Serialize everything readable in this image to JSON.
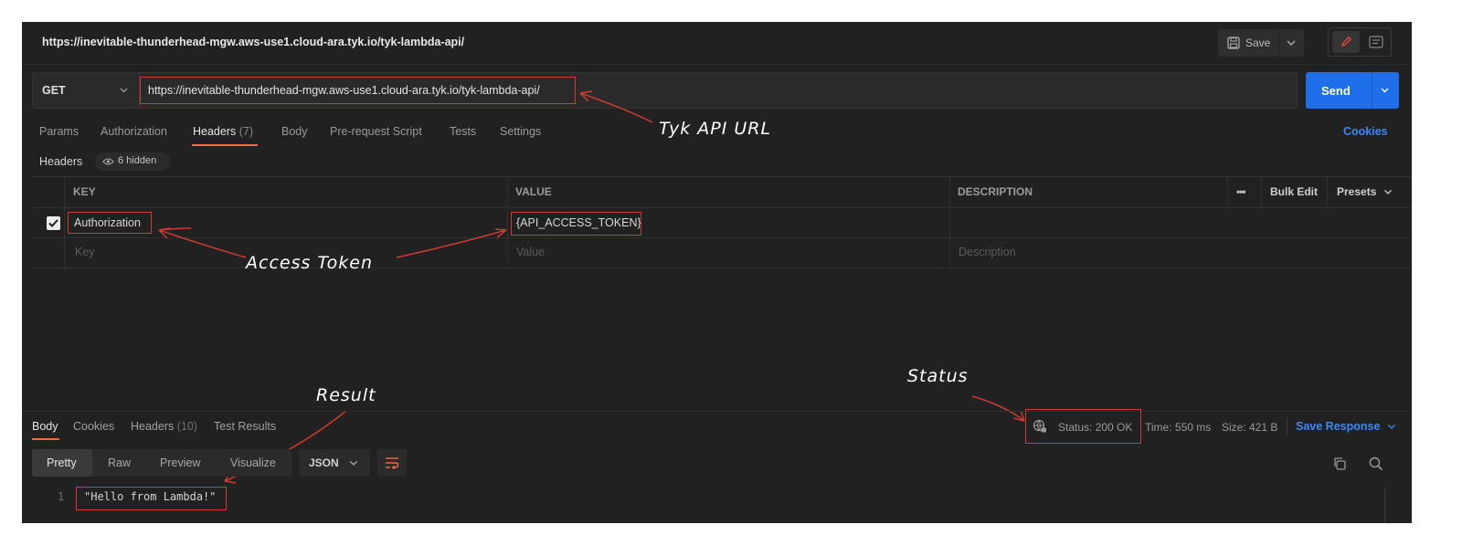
{
  "request": {
    "title": "https://inevitable-thunderhead-mgw.aws-use1.cloud-ara.tyk.io/tyk-lambda-api/",
    "save_label": "Save",
    "method": "GET",
    "url": "https://inevitable-thunderhead-mgw.aws-use1.cloud-ara.tyk.io/tyk-lambda-api/",
    "send_label": "Send"
  },
  "tabs": {
    "params": "Params",
    "authorization": "Authorization",
    "headers": "Headers",
    "headers_count": "(7)",
    "body": "Body",
    "prerequest": "Pre-request Script",
    "tests": "Tests",
    "settings": "Settings",
    "cookies": "Cookies"
  },
  "headers_section": {
    "label": "Headers",
    "hidden": "6 hidden",
    "columns": {
      "key": "KEY",
      "value": "VALUE",
      "description": "DESCRIPTION"
    },
    "more": "•••",
    "bulk_edit": "Bulk Edit",
    "presets": "Presets",
    "rows": [
      {
        "key": "Authorization",
        "value": "{API_ACCESS_TOKEN}",
        "description": ""
      }
    ],
    "placeholders": {
      "key": "Key",
      "value": "Value",
      "description": "Description"
    }
  },
  "response": {
    "tabs": {
      "body": "Body",
      "cookies": "Cookies",
      "headers": "Headers",
      "headers_count": "(10)",
      "test_results": "Test Results"
    },
    "status": "Status: 200 OK",
    "time": "Time: 550 ms",
    "size": "Size: 421 B",
    "save_response": "Save Response",
    "views": {
      "pretty": "Pretty",
      "raw": "Raw",
      "preview": "Preview",
      "visualize": "Visualize"
    },
    "format": "JSON",
    "line_number": "1",
    "body_text": "\"Hello from Lambda!\""
  },
  "annotations": {
    "url": "Tyk API URL",
    "token": "Access Token",
    "result": "Result",
    "status": "Status"
  },
  "colors": {
    "accent_orange": "#ef6c3e",
    "send_blue": "#1f6fea",
    "link_blue": "#3b88f5",
    "annotation_red": "#cf3a32"
  }
}
